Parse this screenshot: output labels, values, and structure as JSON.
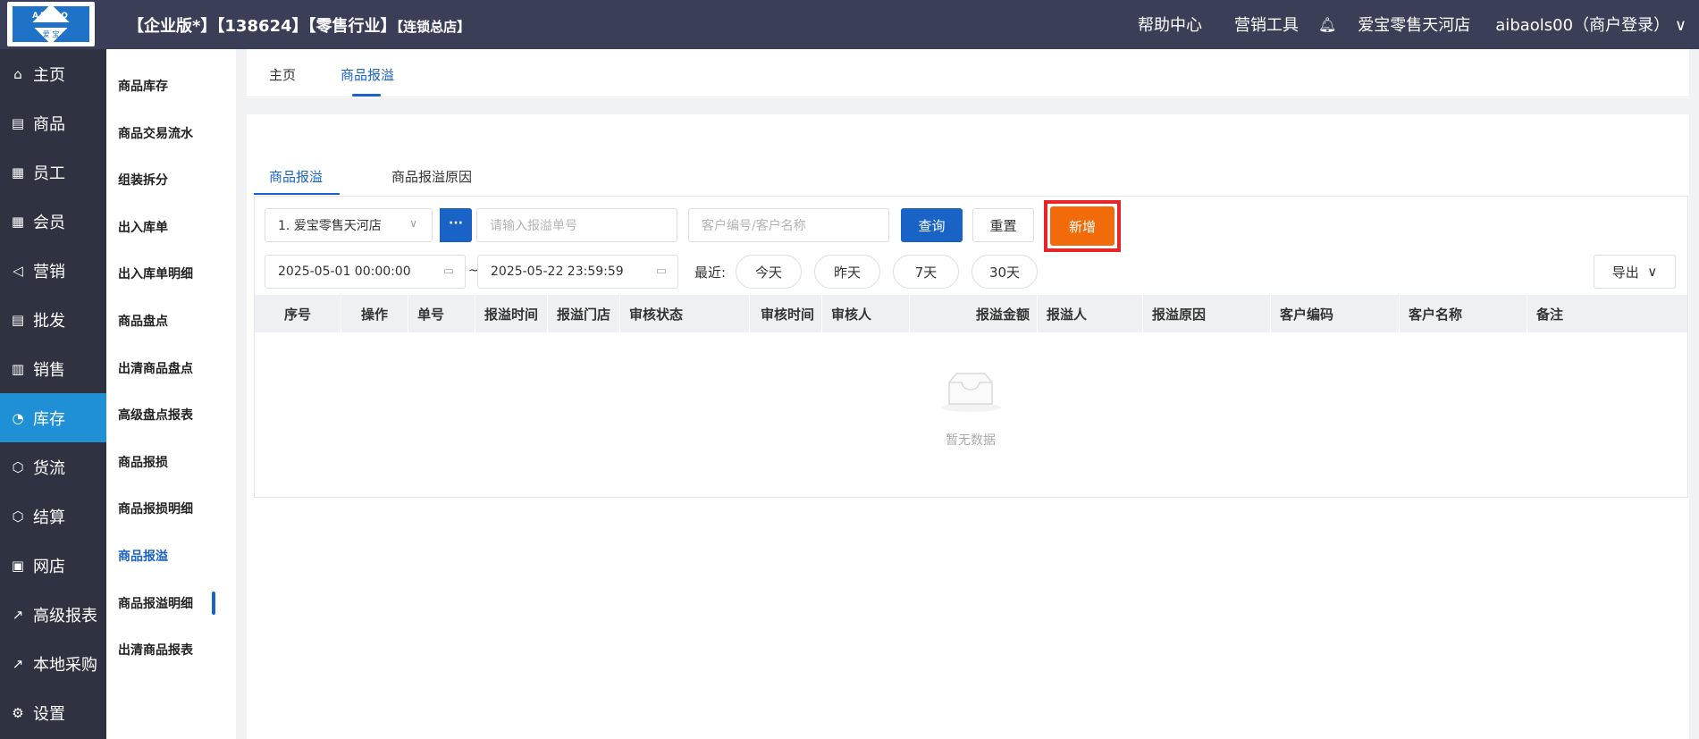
{
  "header": {
    "logo_text": "AIBAO",
    "logo_sub": "爱 宝",
    "title_main": "【企业版*】【138624】【零售行业】",
    "title_small": "【连锁总店】",
    "help": "帮助中心",
    "marketing_tools": "营销工具",
    "store": "爱宝零售天河店",
    "user": "aibaols00（商户登录）"
  },
  "sidebar": {
    "items": [
      {
        "icon": "home-icon",
        "glyph": "⌂",
        "label": "主页"
      },
      {
        "icon": "product-icon",
        "glyph": "▤",
        "label": "商品"
      },
      {
        "icon": "staff-icon",
        "glyph": "▦",
        "label": "员工"
      },
      {
        "icon": "member-icon",
        "glyph": "▦",
        "label": "会员"
      },
      {
        "icon": "marketing-icon",
        "glyph": "◁",
        "label": "营销"
      },
      {
        "icon": "wholesale-icon",
        "glyph": "▤",
        "label": "批发"
      },
      {
        "icon": "sales-icon",
        "glyph": "▥",
        "label": "销售"
      },
      {
        "icon": "inventory-icon",
        "glyph": "◔",
        "label": "库存"
      },
      {
        "icon": "logistics-icon",
        "glyph": "⬡",
        "label": "货流"
      },
      {
        "icon": "settlement-icon",
        "glyph": "⬡",
        "label": "结算"
      },
      {
        "icon": "webstore-icon",
        "glyph": "▣",
        "label": "网店"
      },
      {
        "icon": "report-icon",
        "glyph": "↗",
        "label": "高级报表"
      },
      {
        "icon": "purchase-icon",
        "glyph": "↗",
        "label": "本地采购"
      },
      {
        "icon": "settings-icon",
        "glyph": "⚙",
        "label": "设置"
      }
    ],
    "active_index": 7
  },
  "submenu": {
    "items": [
      "商品库存",
      "商品交易流水",
      "组装拆分",
      "出入库单",
      "出入库单明细",
      "商品盘点",
      "出清商品盘点",
      "高级盘点报表",
      "商品报损",
      "商品报损明细",
      "商品报溢",
      "商品报溢明细",
      "出清商品报表"
    ],
    "active_index": 10
  },
  "tabs": {
    "home": "主页",
    "current": "商品报溢"
  },
  "inner_tabs": {
    "tab1": "商品报溢",
    "tab2": "商品报溢原因"
  },
  "filters": {
    "store_select": "1. 爱宝零售天河店",
    "more": "···",
    "order_no_placeholder": "请输入报溢单号",
    "customer_placeholder": "客户编号/客户名称",
    "query": "查询",
    "reset": "重置",
    "add": "新增",
    "date_start": "2025-05-01 00:00:00",
    "date_sep": "~",
    "date_end": "2025-05-22 23:59:59",
    "recent_label": "最近:",
    "today": "今天",
    "yesterday": "昨天",
    "days7": "7天",
    "days30": "30天",
    "export": "导出"
  },
  "table": {
    "columns": [
      "序号",
      "操作",
      "单号",
      "报溢时间",
      "报溢门店",
      "审核状态",
      "审核时间",
      "审核人",
      "报溢金额",
      "报溢人",
      "报溢原因",
      "客户编码",
      "客户名称",
      "备注"
    ],
    "rows": [],
    "empty_text": "暂无数据"
  },
  "colors": {
    "header_bg": "#3b3e57",
    "sidebar_bg": "#2f3240",
    "sidebar_active": "#1f8fd6",
    "primary": "#1a63c6",
    "add_button": "#f26b0a",
    "highlight_box": "#e8262a"
  }
}
